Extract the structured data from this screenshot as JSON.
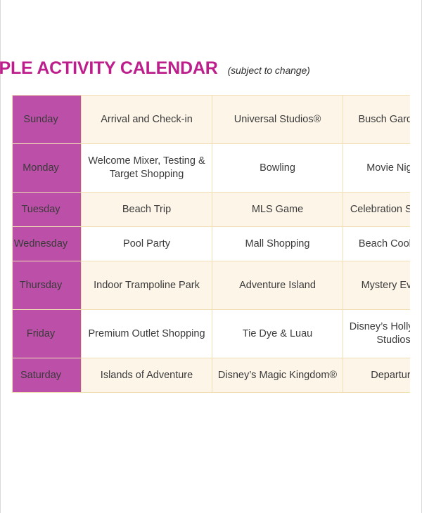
{
  "document": {
    "title": "AMPLE ACTIVITY CALENDAR",
    "title_full": "SAMPLE ACTIVITY CALENDAR",
    "subtitle": "(subject to change)"
  },
  "colors": {
    "title": "#bc1f8c",
    "day_column": "#bc4fa8",
    "row_cream": "#fdf5e8",
    "row_white": "#ffffff",
    "cell_border": "#f0dfb4",
    "cell_text": "#3a3a3a"
  },
  "calendar": {
    "rows": [
      {
        "day": "Sunday",
        "shade": "cream",
        "height": "tall",
        "activities": [
          "Arrival and Check-in",
          "Universal Studios®",
          "Busch Gardens",
          ""
        ]
      },
      {
        "day": "Monday",
        "shade": "white",
        "height": "tall",
        "activities": [
          "Welcome Mixer, Testing & Target Shopping",
          "Bowling",
          "Movie Night",
          ""
        ]
      },
      {
        "day": "Tuesday",
        "shade": "cream",
        "height": "short",
        "activities": [
          "Beach Trip",
          "MLS Game",
          "Celebration Station",
          ""
        ]
      },
      {
        "day": "Wednesday",
        "shade": "white",
        "height": "short",
        "activities": [
          "Pool Party",
          "Mall Shopping",
          "Beach Cookout",
          ""
        ]
      },
      {
        "day": "Thursday",
        "shade": "cream",
        "height": "tall",
        "activities": [
          "Indoor Trampoline Park",
          "Adventure Island",
          "Mystery Event",
          ""
        ]
      },
      {
        "day": "Friday",
        "shade": "white",
        "height": "tall",
        "activities": [
          "Premium Outlet Shopping",
          "Tie Dye & Luau",
          "Disney’s Hollywood Studios",
          ""
        ]
      },
      {
        "day": "Saturday",
        "shade": "cream",
        "height": "short",
        "activities": [
          "Islands of Adventure",
          "Disney’s Magic Kingdom®",
          "Departure",
          ""
        ]
      }
    ]
  }
}
